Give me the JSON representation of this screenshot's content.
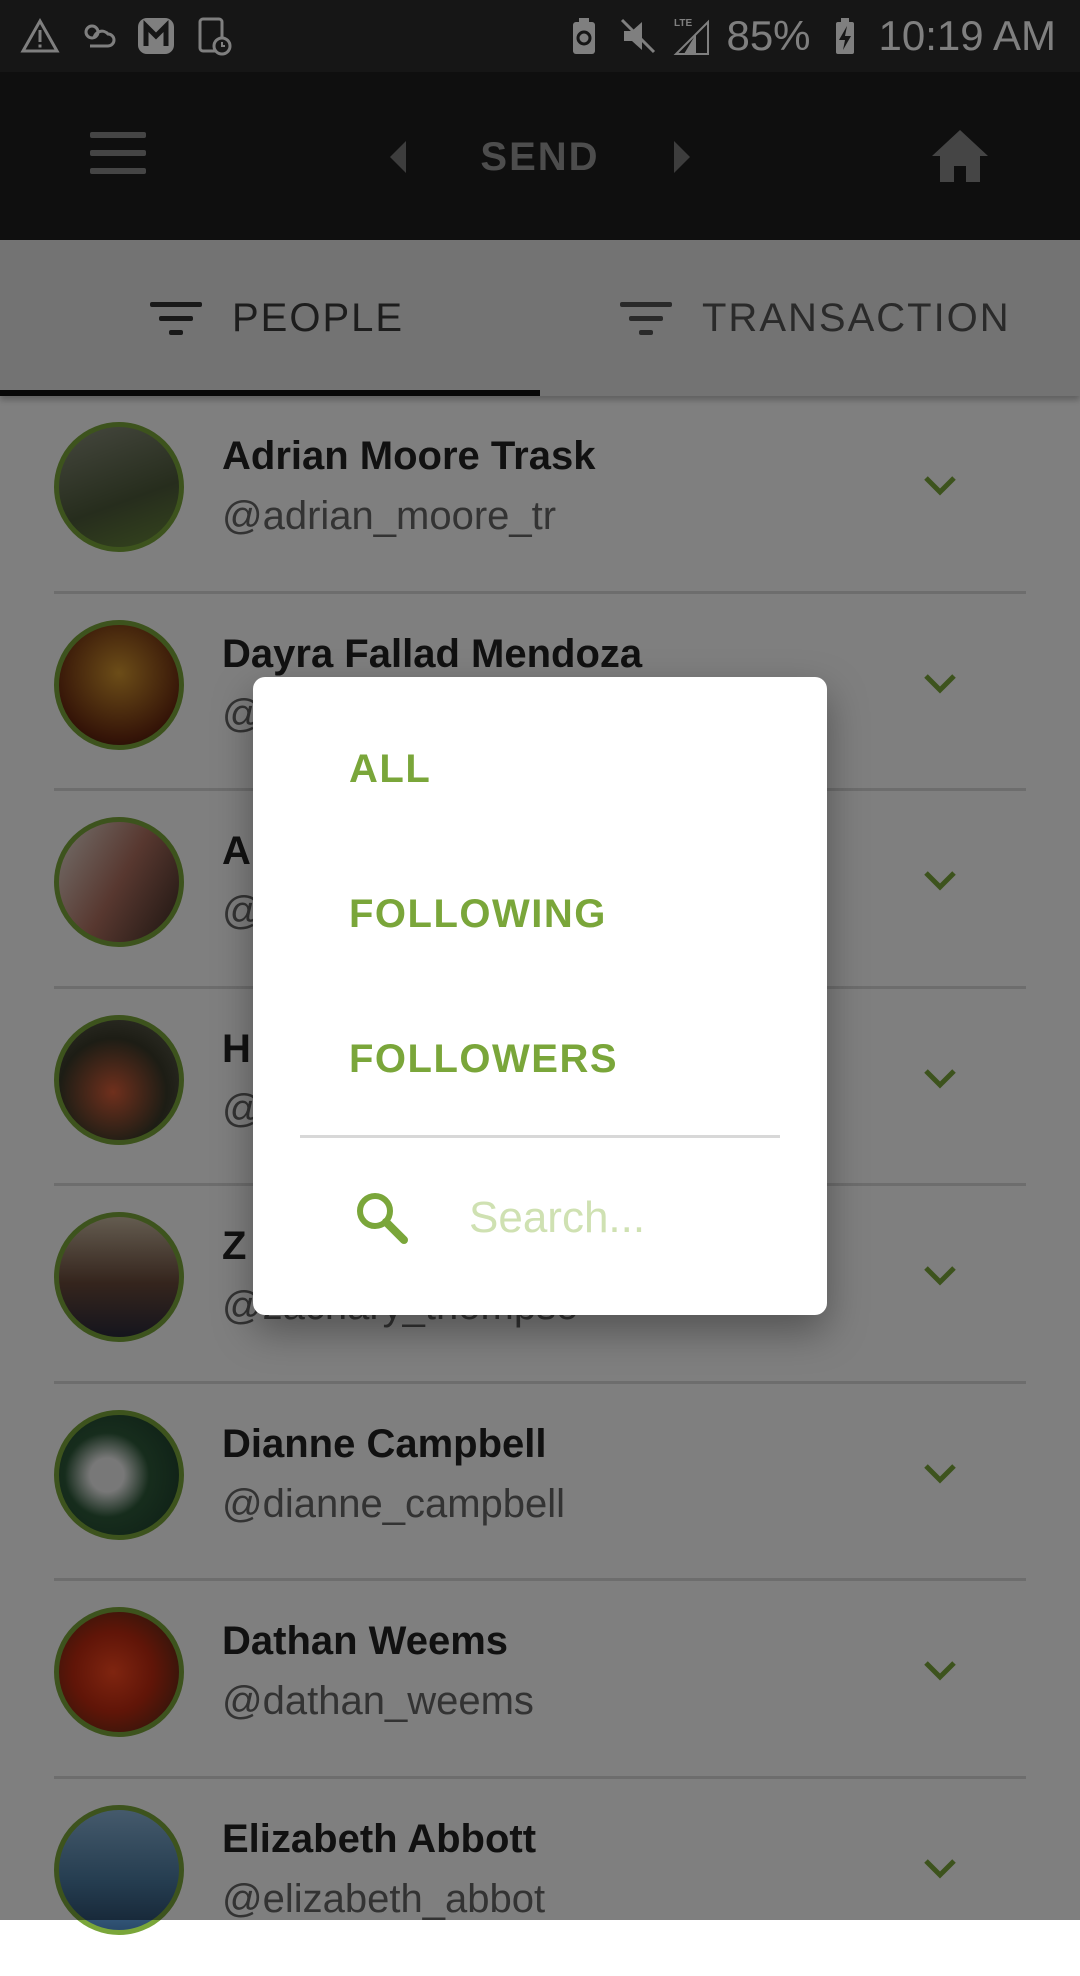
{
  "status_bar": {
    "battery_percent": "85%",
    "time": "10:19 AM",
    "icons": [
      "warning-icon",
      "weather-icon",
      "m-app-icon",
      "sim-icon",
      "battery-saver-icon",
      "mute-icon",
      "lte-signal-icon",
      "battery-icon"
    ]
  },
  "app_bar": {
    "title": "SEND",
    "icons": [
      "menu-icon",
      "prev-arrow-icon",
      "next-arrow-icon",
      "home-icon"
    ]
  },
  "tabs": [
    {
      "label": "PEOPLE",
      "selected": true,
      "icon": "filter-icon"
    },
    {
      "label": "TRANSACTION",
      "selected": false,
      "icon": "filter-icon"
    }
  ],
  "people": [
    {
      "name": "Adrian Moore Trask",
      "handle": "@adrian_moore_tr"
    },
    {
      "name": "Dayra Fallad Mendoza",
      "handle": "@"
    },
    {
      "name": "A",
      "handle": "@"
    },
    {
      "name": "H",
      "handle": "@"
    },
    {
      "name": "Z",
      "handle": "@zachary_thompso"
    },
    {
      "name": "Dianne Campbell",
      "handle": "@dianne_campbell"
    },
    {
      "name": "Dathan Weems",
      "handle": "@dathan_weems"
    },
    {
      "name": "Elizabeth Abbott",
      "handle": "@elizabeth_abbot"
    }
  ],
  "dialog": {
    "options": [
      "ALL",
      "FOLLOWING",
      "FOLLOWERS"
    ],
    "search_placeholder": "Search...",
    "search_value": ""
  },
  "colors": {
    "accent": "#7aa63a",
    "avatar_ring": "#7aa63a",
    "app_bar": "#1f1f1f",
    "status_bar": "#2c2c2c"
  }
}
